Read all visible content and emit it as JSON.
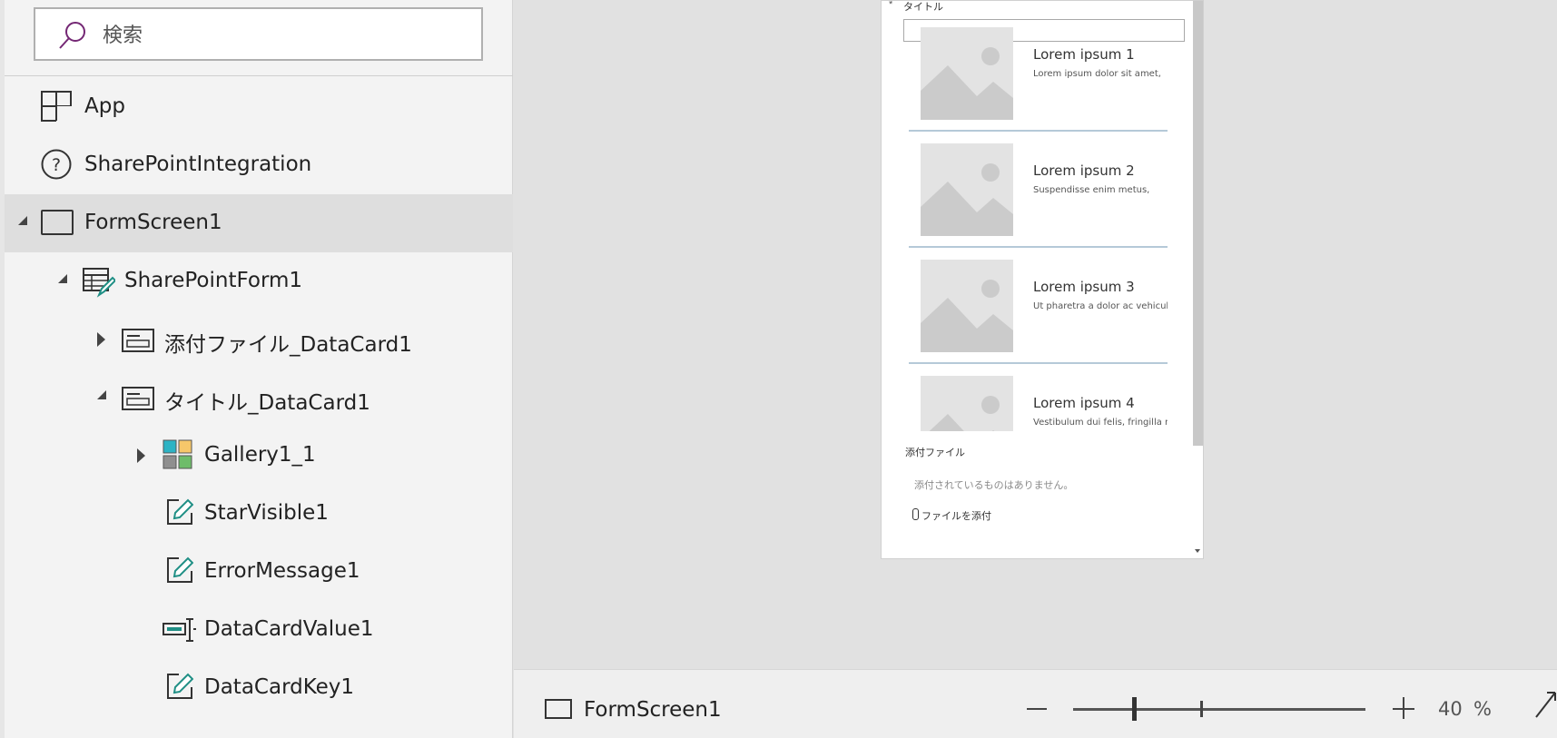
{
  "search": {
    "placeholder": "検索"
  },
  "tree": {
    "items": [
      {
        "label": "App"
      },
      {
        "label": "SharePointIntegration"
      },
      {
        "label": "FormScreen1"
      },
      {
        "label": "SharePointForm1"
      },
      {
        "label": "添付ファイル_DataCard1"
      },
      {
        "label": "タイトル_DataCard1"
      },
      {
        "label": "Gallery1_1"
      },
      {
        "label": "StarVisible1"
      },
      {
        "label": "ErrorMessage1"
      },
      {
        "label": "DataCardValue1"
      },
      {
        "label": "DataCardKey1"
      }
    ]
  },
  "preview": {
    "required_star": "*",
    "title_label": "タイトル",
    "gallery": [
      {
        "title": "Lorem ipsum 1",
        "subtitle": "Lorem ipsum dolor sit amet,"
      },
      {
        "title": "Lorem ipsum 2",
        "subtitle": "Suspendisse enim metus,"
      },
      {
        "title": "Lorem ipsum 3",
        "subtitle": "Ut pharetra a dolor ac vehicula."
      },
      {
        "title": "Lorem ipsum 4",
        "subtitle": "Vestibulum dui felis, fringilla nec"
      }
    ],
    "attachments_label": "添付ファイル",
    "attachments_empty": "添付されているものはありません。",
    "attach_link": "ファイルを添付"
  },
  "status_bar": {
    "screen_name": "FormScreen1",
    "zoom_value": "40",
    "zoom_unit": "%",
    "zoom_level_percent": 40
  },
  "colors": {
    "accent": "#742774",
    "teal": "#1f8f85",
    "selected_row": "#dedede"
  }
}
